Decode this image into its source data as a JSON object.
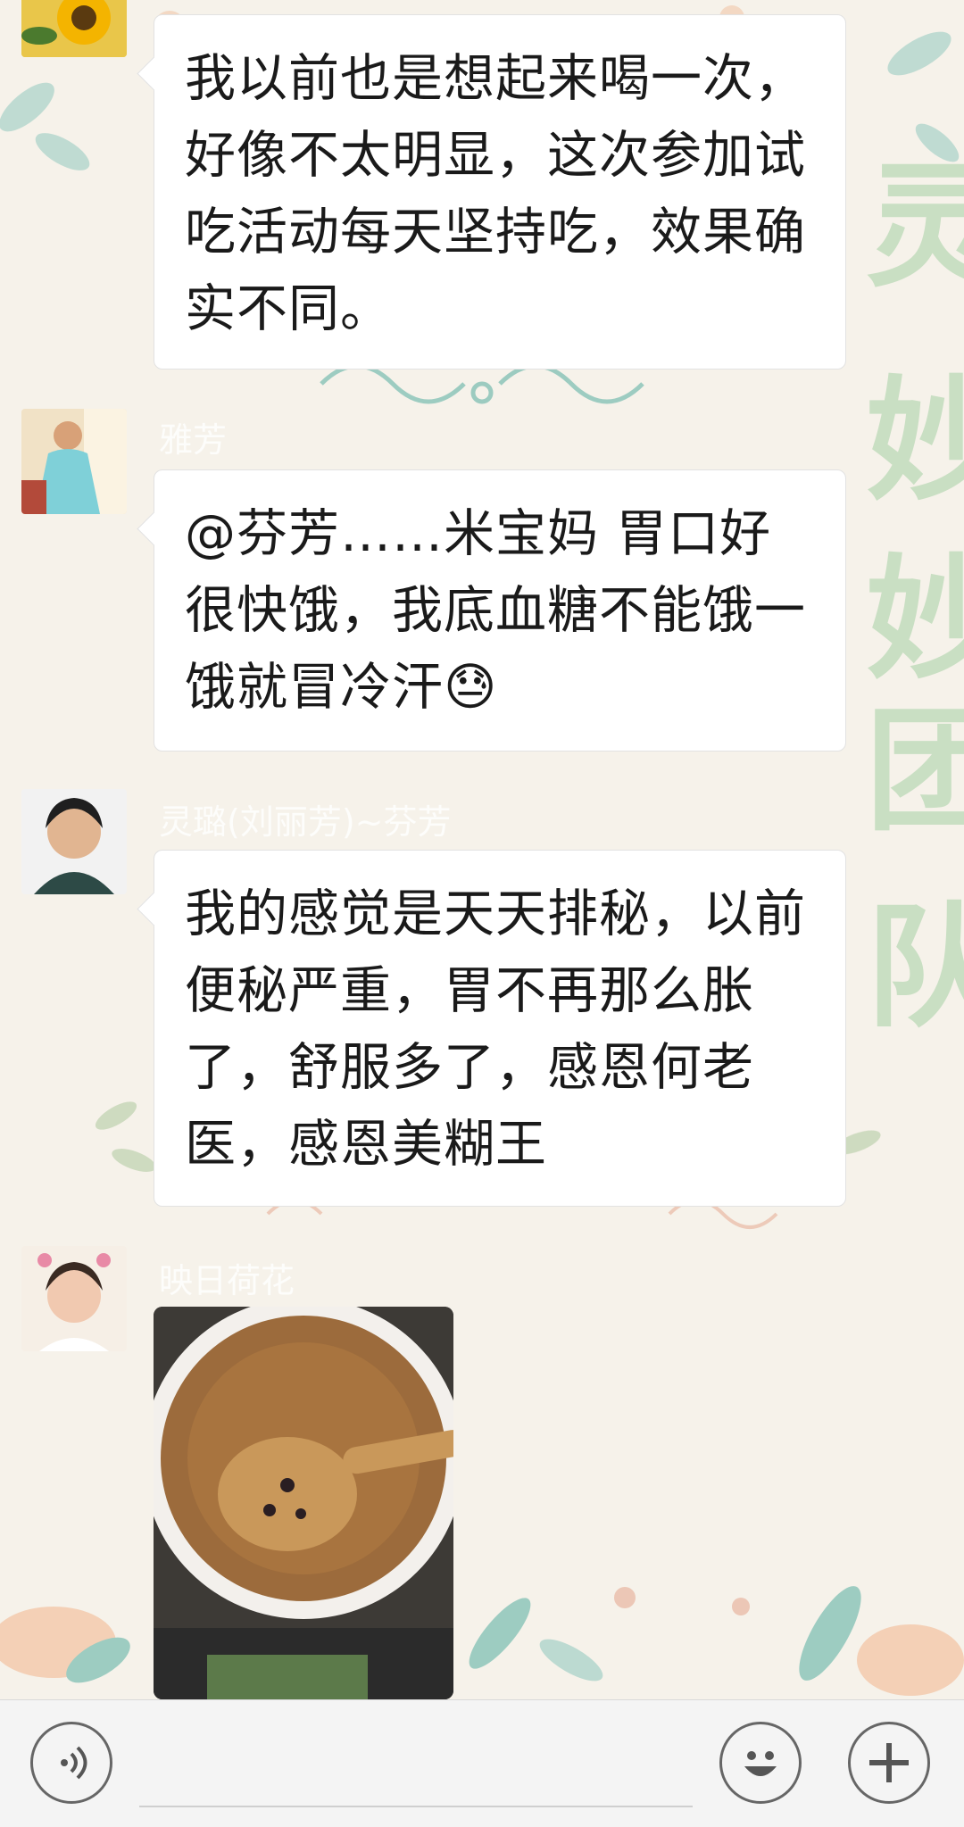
{
  "messages": [
    {
      "sender": "",
      "text": "我以前也是想起来喝一次，好像不太明显，这次参加试吃活动每天坚持吃，效果确实不同。"
    },
    {
      "sender": "雅芳",
      "text": "@芬芳……米宝妈  胃口好很快饿，我底血糖不能饿一饿就冒冷汗😓"
    },
    {
      "sender": "灵璐(刘丽芳)~芬芳",
      "text": "我的感觉是天天排秘，以前便秘严重，胃不再那么胀了，舒服多了，感恩何老医，感恩美糊王"
    },
    {
      "sender": "映日荷花",
      "text": ""
    }
  ],
  "wallpaper_text": [
    "灵",
    "妙",
    "妙",
    "团",
    "队"
  ],
  "input_bar": {
    "voice_icon": "voice-icon",
    "emoji_icon": "emoji-icon",
    "plus_icon": "plus-icon"
  },
  "colors": {
    "bubble": "#ffffff",
    "background": "#f6f2ea",
    "watermark": "#c9dfc3"
  }
}
